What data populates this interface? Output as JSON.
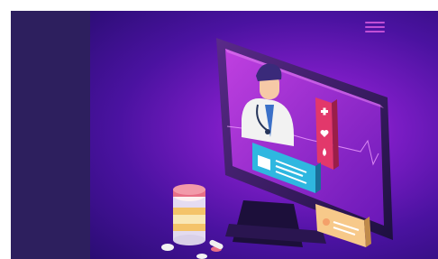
{
  "layout": {
    "sidebar_color": "#2d1f5e",
    "hero_gradient": [
      "#b62fd9",
      "#7a1cc4",
      "#4a12a0",
      "#2a0d73"
    ]
  },
  "header": {
    "menu_icon": "hamburger-menu-icon",
    "accent": "#c14fd6"
  },
  "illustration": {
    "subject": "telemedicine-doctor-on-monitor",
    "icons": [
      "plus-icon",
      "heart-icon",
      "blood-drop-icon",
      "patient-card-icon",
      "pill-bottle-icon",
      "capsule-icon"
    ]
  }
}
